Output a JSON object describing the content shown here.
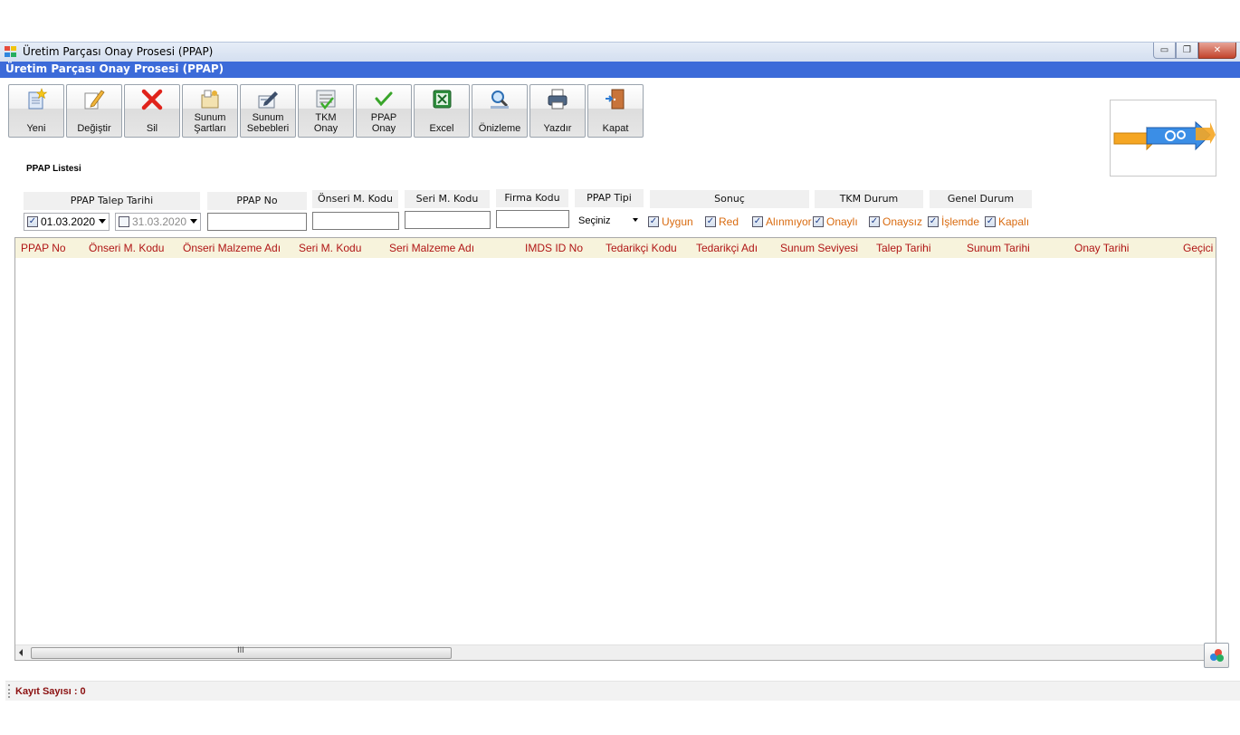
{
  "window": {
    "title": "Üretim Parçası Onay Prosesi (PPAP)",
    "header": "Üretim Parçası Onay Prosesi (PPAP)",
    "controls": {
      "minimize": "▭",
      "restore": "❐",
      "close": "✕"
    }
  },
  "toolbar": {
    "buttons": [
      {
        "label": "Yeni",
        "icon": "new-document-star-icon"
      },
      {
        "label": "Değiştir",
        "icon": "edit-pencil-icon"
      },
      {
        "label": "Sil",
        "icon": "delete-x-icon"
      },
      {
        "label": "Sunum\nŞartları",
        "icon": "presentation-conditions-icon"
      },
      {
        "label": "Sunum\nSebebleri",
        "icon": "presentation-reasons-icon"
      },
      {
        "label": "TKM\nOnay",
        "icon": "tkm-approve-icon"
      },
      {
        "label": "PPAP\nOnay",
        "icon": "ppap-approve-check-icon"
      },
      {
        "label": "Excel",
        "icon": "excel-icon"
      },
      {
        "label": "Önizleme",
        "icon": "preview-magnifier-icon"
      },
      {
        "label": "Yazdır",
        "icon": "printer-icon"
      },
      {
        "label": "Kapat",
        "icon": "exit-door-icon"
      }
    ]
  },
  "section_title": "PPAP Listesi",
  "filters": {
    "labels": {
      "talep_tarihi": "PPAP Talep Tarihi",
      "ppap_no": "PPAP No",
      "onseri_kodu": "Önseri M. Kodu",
      "seri_kodu": "Seri M. Kodu",
      "firma_kodu": "Firma Kodu",
      "ppap_tipi": "PPAP Tipi",
      "sonuc": "Sonuç",
      "tkm_durum": "TKM Durum",
      "genel_durum": "Genel Durum"
    },
    "date_from": "01.03.2020",
    "date_to": "31.03.2020",
    "ppap_tipi_value": "Seçiniz",
    "status_checks": [
      "Uygun",
      "Red",
      "Alınmıyor",
      "Onaylı",
      "Onaysız",
      "İşlemde",
      "Kapalı"
    ]
  },
  "grid": {
    "columns": [
      "PPAP No",
      "Önseri M. Kodu",
      "Önseri Malzeme Adı",
      "Seri M. Kodu",
      "Seri Malzeme Adı",
      "IMDS ID No",
      "Tedarikçi Kodu",
      "Tedarikçi Adı",
      "Sunum Seviyesi",
      "Talep Tarihi",
      "Sunum Tarihi",
      "Onay Tarihi",
      "Geçici O"
    ],
    "scroll_grip": "III"
  },
  "status": {
    "record_count": "Kayıt Sayısı : 0"
  }
}
